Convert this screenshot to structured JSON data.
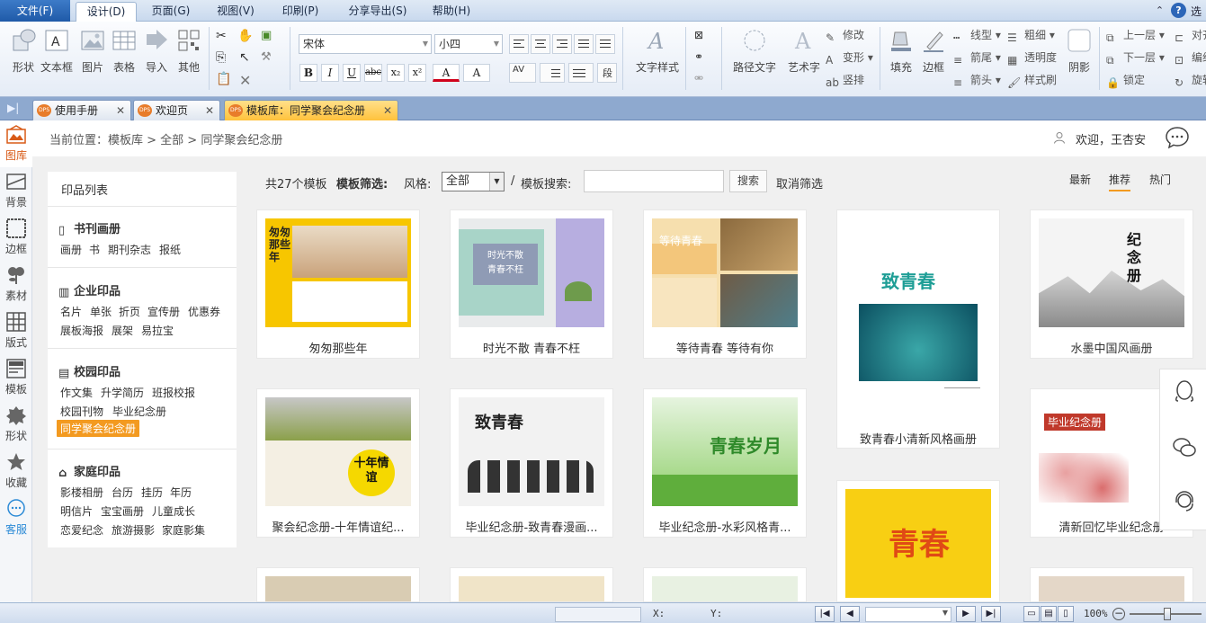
{
  "menubar": {
    "file": "文件(F)",
    "items": [
      "设计(D)",
      "页面(G)",
      "视图(V)",
      "印刷(P)",
      "分享导出(S)",
      "帮助(H)"
    ],
    "active_index": 0,
    "right_label": "选"
  },
  "ribbon": {
    "insert_group": [
      "形状",
      "文本框",
      "图片",
      "表格",
      "导入",
      "其他"
    ],
    "font_name": "宋体",
    "font_size": "小四",
    "format_buttons": [
      "B",
      "I",
      "U",
      "abc",
      "x₂",
      "x²",
      "A",
      "A"
    ],
    "text_style": "文字样式",
    "path_text": "路径文字",
    "art_text": "艺术字",
    "art_small": [
      "修改",
      "变形",
      "竖排"
    ],
    "fill": "填充",
    "border": "边框",
    "line_group": [
      "线型",
      "箭尾",
      "箭头"
    ],
    "thick_group": [
      "粗细",
      "透明度",
      "样式刷"
    ],
    "shadow": "阴影",
    "layer_group": [
      "上一层",
      "下一层",
      "锁定"
    ],
    "align_group": [
      "对齐",
      "编组",
      "旋转"
    ]
  },
  "tabs": [
    {
      "label": "使用手册",
      "active": false
    },
    {
      "label": "欢迎页",
      "active": false
    },
    {
      "label": "模板库：同学聚会纪念册",
      "active": true
    }
  ],
  "lefttool": [
    "图库",
    "背景",
    "边框",
    "素材",
    "版式",
    "模板",
    "形状",
    "收藏",
    "客服"
  ],
  "breadcrumb": "当前位置：模板库 > 全部 > 同学聚会纪念册",
  "welcome": "欢迎，王杏安",
  "catalog": {
    "title": "印品列表",
    "groups": [
      {
        "name": "书刊画册",
        "items": [
          "画册",
          "书",
          "期刊杂志",
          "报纸"
        ]
      },
      {
        "name": "企业印品",
        "items": [
          "名片",
          "单张",
          "折页",
          "宣传册",
          "优惠券",
          "展板海报",
          "展架",
          "易拉宝"
        ]
      },
      {
        "name": "校园印品",
        "items": [
          "作文集",
          "升学简历",
          "班报校报",
          "校园刊物",
          "毕业纪念册",
          "同学聚会纪念册"
        ]
      },
      {
        "name": "家庭印品",
        "items": [
          "影楼相册",
          "台历",
          "挂历",
          "年历",
          "明信片",
          "宝宝画册",
          "儿童成长",
          "恋爱纪念",
          "旅游摄影",
          "家庭影集"
        ]
      }
    ],
    "selected": "同学聚会纪念册"
  },
  "filter": {
    "count_text": "共27个模板",
    "filter_label": "模板筛选:",
    "style_label": "风格:",
    "style_value": "全部",
    "slash": "/",
    "search_label": "模板搜索:",
    "search_value": "",
    "search_button": "搜索",
    "cancel": "取消筛选",
    "sort_tabs": [
      "最新",
      "推荐",
      "热门"
    ],
    "sort_active": "推荐"
  },
  "cards": [
    {
      "title": "匆匆那些年",
      "thumb_text": "匆匆那些年"
    },
    {
      "title": "时光不散 青春不枉",
      "thumb_text": "时光不散\n青春不枉"
    },
    {
      "title": "等待青春 等待有你",
      "thumb_text": "等待青春"
    },
    {
      "title": "致青春小清新风格画册",
      "thumb_text": "致青春"
    },
    {
      "title": "水墨中国风画册",
      "thumb_text": "纪念册"
    },
    {
      "title": "聚会纪念册-十年情谊纪...",
      "thumb_text": "十年情谊"
    },
    {
      "title": "毕业纪念册-致青春漫画...",
      "thumb_text": "致青春"
    },
    {
      "title": "毕业纪念册-水彩风格青...",
      "thumb_text": "青春岁月"
    },
    {
      "title": "",
      "thumb_text": "青春"
    },
    {
      "title": "清新回忆毕业纪念册",
      "thumb_text": "毕业纪念册"
    }
  ],
  "statusbar": {
    "x_label": "X:",
    "y_label": "Y:",
    "zoom": "100%"
  },
  "colors": {
    "accent_orange": "#f39a20",
    "menu_blue": "#1f5aa8",
    "tab_active": "#ffc23c"
  }
}
